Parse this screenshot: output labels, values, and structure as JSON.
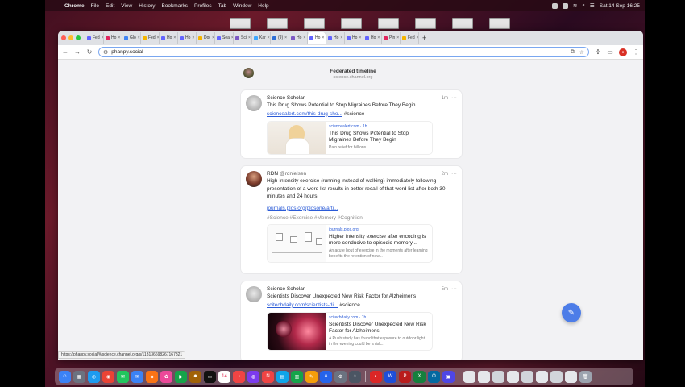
{
  "menubar": {
    "app": "Chrome",
    "menus": [
      "File",
      "Edit",
      "View",
      "History",
      "Bookmarks",
      "Profiles",
      "Tab",
      "Window",
      "Help"
    ],
    "clock": "Sat 14 Sep 16:25"
  },
  "tabs": [
    {
      "label": "Fed",
      "color": "#6364ff"
    },
    {
      "label": "Ho",
      "color": "#e0245e"
    },
    {
      "label": "Glo",
      "color": "#4285f4"
    },
    {
      "label": "Fed",
      "color": "#f4b400"
    },
    {
      "label": "Ho",
      "color": "#6364ff"
    },
    {
      "label": "Ho",
      "color": "#6364ff"
    },
    {
      "label": "Dor",
      "color": "#f4b400"
    },
    {
      "label": "Sea",
      "color": "#6364ff"
    },
    {
      "label": "Sci",
      "color": "#7d59c5"
    },
    {
      "label": "Kar",
      "color": "#3ea8ff"
    },
    {
      "label": "(9)",
      "color": "#2f6fd6"
    },
    {
      "label": "Ho",
      "color": "#7d59c5"
    },
    {
      "label": "Ho",
      "color": "#6364ff"
    },
    {
      "label": "Ho",
      "color": "#6364ff"
    },
    {
      "label": "Ho",
      "color": "#6364ff"
    },
    {
      "label": "Ho",
      "color": "#6364ff"
    },
    {
      "label": "Pin",
      "color": "#e0245e"
    },
    {
      "label": "Fed",
      "color": "#f4b400"
    }
  ],
  "active_tab": 12,
  "address": {
    "url": "phanpy.social"
  },
  "timeline": {
    "title": "Federated timeline",
    "subtitle": "science.channel.org"
  },
  "posts": [
    {
      "author": "Science Scholar",
      "handle": "",
      "time": "1m",
      "text": "This Drug Shows Potential to Stop Migraines Before They Begin",
      "link": "sciencealert.com/this-drug-sho...",
      "hashtag": "#science",
      "card": {
        "domain": "sciencealert.com · 1h",
        "title": "This Drug Shows Potential to Stop Migraines Before They Begin",
        "desc": "Pain relief for billions."
      }
    },
    {
      "author": "RDN",
      "handle": "@rdnielsen",
      "time": "2m",
      "text": "High-intensity exercise (running instead of walking) immediately following presentation of a word list results in better recall of that word list after both 30 minutes and 24 hours.",
      "link": "journals.plos.org/plosone/arti...",
      "hashtags": "#Science #Exercise #Memory #Cognition",
      "card": {
        "domain": "journals.plos.org",
        "title": "Higher intensity exercise after encoding is more conducive to episodic memory...",
        "desc": "An acute bout of exercise in the moments after learning benefits the retention of new..."
      }
    },
    {
      "author": "Science Scholar",
      "handle": "",
      "time": "5m",
      "text": "Scientists Discover Unexpected New Risk Factor for Alzheimer's",
      "link": "scitechdaily.com/scientists-di...",
      "hashtag": "#science",
      "card": {
        "domain": "scitechdaily.com · 1h",
        "title": "Scientists Discover Unexpected New Risk Factor for Alzheimer's",
        "desc": "A Rush study has found that exposure to outdoor light in the evening could be a risk..."
      }
    }
  ],
  "status_url": "https://phanpy.social/#/science.channel.org/s/113136698267167821",
  "desktop_files": [
    "2024-0...16.53.39",
    "2024-0...12.27.59",
    "2024-0...16.16.13",
    "2024-0...22.56.05",
    "8f-4b2e...92d.jpeg",
    "2024-0...08.12.56",
    "2024-0...16.22.54"
  ]
}
